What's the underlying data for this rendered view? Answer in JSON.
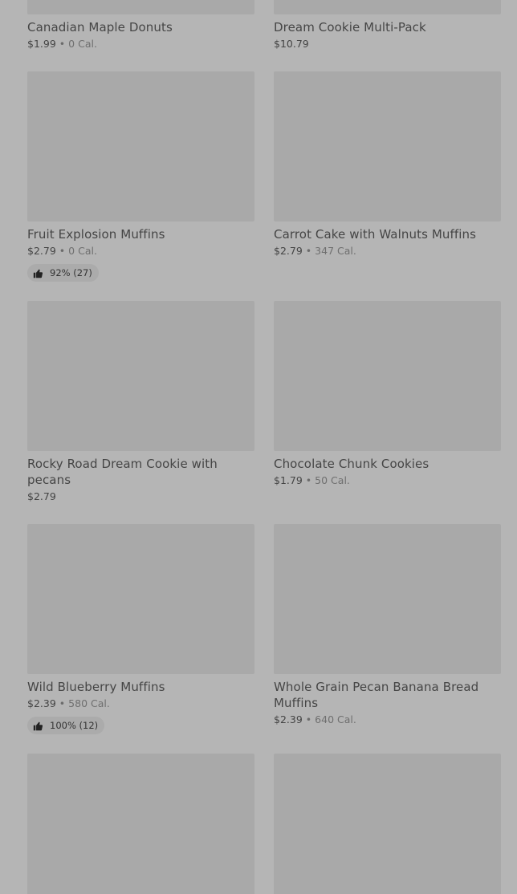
{
  "items": [
    {
      "name": "Canadian Maple Donuts",
      "price": "$1.99",
      "calories": "0 Cal.",
      "rating": ""
    },
    {
      "name": "Dream Cookie Multi-Pack",
      "price": "$10.79",
      "calories": "",
      "rating": ""
    },
    {
      "name": "Fruit Explosion Muffins",
      "price": "$2.79",
      "calories": "0 Cal.",
      "rating": "92% (27)"
    },
    {
      "name": "Carrot Cake with Walnuts Muffins",
      "price": "$2.79",
      "calories": "347 Cal.",
      "rating": ""
    },
    {
      "name": "Rocky Road Dream Cookie with pecans",
      "price": "$2.79",
      "calories": "",
      "rating": ""
    },
    {
      "name": "Chocolate Chunk Cookies",
      "price": "$1.79",
      "calories": "50 Cal.",
      "rating": ""
    },
    {
      "name": "Wild Blueberry Muffins",
      "price": "$2.39",
      "calories": "580 Cal.",
      "rating": "100% (12)"
    },
    {
      "name": "Whole Grain Pecan Banana Bread Muffins",
      "price": "$2.39",
      "calories": "640 Cal.",
      "rating": ""
    },
    {
      "name": "",
      "price": "",
      "calories": "",
      "rating": ""
    },
    {
      "name": "",
      "price": "",
      "calories": "",
      "rating": ""
    }
  ]
}
